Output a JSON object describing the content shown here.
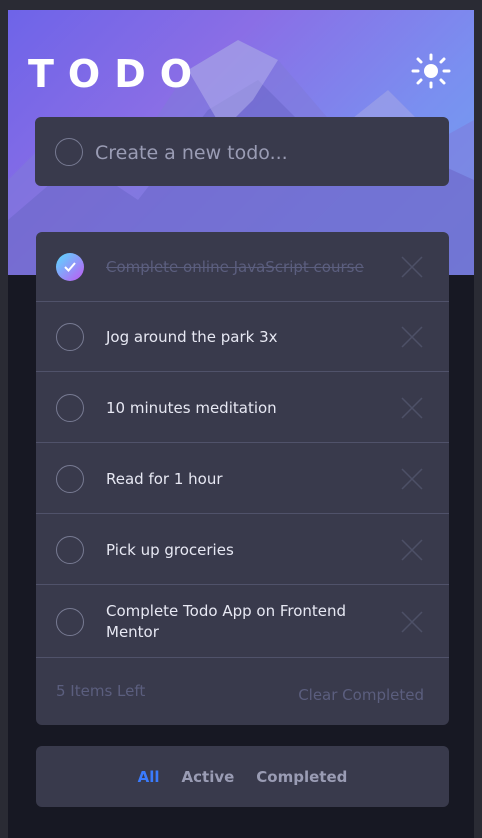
{
  "app": {
    "title": "TODO"
  },
  "header": {
    "theme_toggle_icon": "sun-icon"
  },
  "new_todo": {
    "placeholder": "Create a new todo..."
  },
  "todos": [
    {
      "text": "Complete online JavaScript course",
      "completed": true
    },
    {
      "text": "Jog around the park 3x",
      "completed": false
    },
    {
      "text": "10 minutes meditation",
      "completed": false
    },
    {
      "text": "Read for 1 hour",
      "completed": false
    },
    {
      "text": "Pick up groceries",
      "completed": false
    },
    {
      "text": "Complete Todo App on Frontend Mentor",
      "completed": false
    }
  ],
  "footer": {
    "items_left": "5 Items Left",
    "clear_label": "Clear Completed"
  },
  "filters": {
    "all": "All",
    "active": "Active",
    "completed": "Completed",
    "selected": "All"
  },
  "colors": {
    "accent": "#3a7bfd",
    "check_gradient_start": "#57ddff",
    "check_gradient_end": "#c058f3",
    "card_bg": "#393a4c",
    "page_bg": "#171823"
  }
}
